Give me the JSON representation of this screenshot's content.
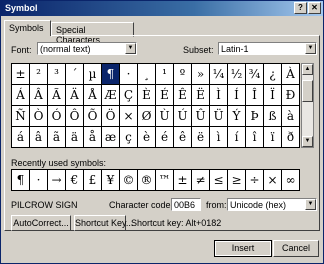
{
  "window": {
    "title": "Symbol",
    "help": "?",
    "close": "✕"
  },
  "tabs": [
    "Symbols",
    "Special Characters"
  ],
  "font": {
    "label": "Font:",
    "value": "(normal text)"
  },
  "subset": {
    "label": "Subset:",
    "value": "Latin-1"
  },
  "symbols": [
    "±",
    "²",
    "³",
    "´",
    "µ",
    "¶",
    "·",
    "¸",
    "¹",
    "º",
    "»",
    "¼",
    "½",
    "¾",
    "¿",
    "À",
    "Á",
    "Â",
    "Ã",
    "Ä",
    "Å",
    "Æ",
    "Ç",
    "È",
    "É",
    "Ê",
    "Ë",
    "Ì",
    "Í",
    "Î",
    "Ï",
    "Ð",
    "Ñ",
    "Ò",
    "Ó",
    "Ô",
    "Õ",
    "Ö",
    "×",
    "Ø",
    "Ù",
    "Ú",
    "Û",
    "Ü",
    "Ý",
    "Þ",
    "ß",
    "à",
    "á",
    "â",
    "ã",
    "ä",
    "å",
    "æ",
    "ç",
    "è",
    "é",
    "ê",
    "ë",
    "ì",
    "í",
    "î",
    "ï",
    "ð"
  ],
  "selected_symbol": "¶",
  "recent_label": "Recently used symbols:",
  "recent_symbols": [
    "¶",
    "·",
    "→",
    "€",
    "£",
    "¥",
    "©",
    "®",
    "™",
    "±",
    "≠",
    "≤",
    "≥",
    "÷",
    "×",
    "∞"
  ],
  "char_name": "PILCROW SIGN",
  "char_code": {
    "label": "Character code:",
    "value": "00B6"
  },
  "from": {
    "label": "from:",
    "value": "Unicode (hex)"
  },
  "autocorrect": "AutoCorrect...",
  "shortcut_key": "Shortcut Key...",
  "shortcut_text": "Shortcut key: Alt+0182",
  "insert": "Insert",
  "cancel": "Cancel"
}
